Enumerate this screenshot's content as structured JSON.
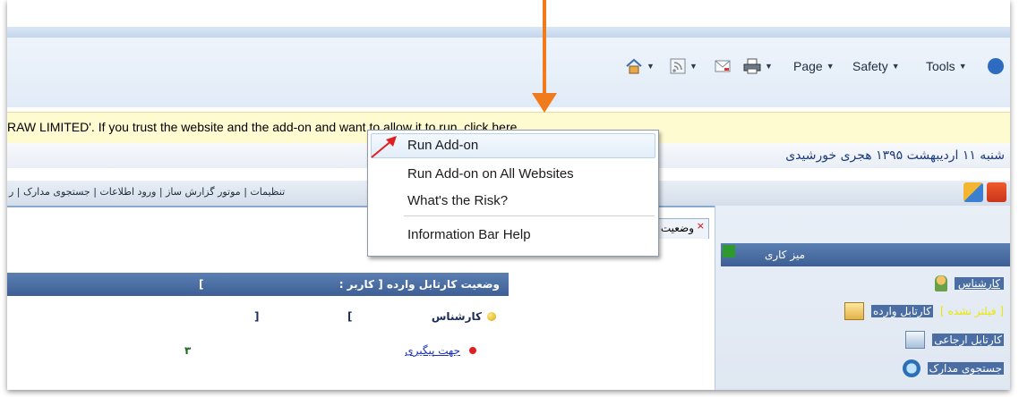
{
  "toolbar": {
    "page_label": "Page",
    "safety_label": "Safety",
    "tools_label": "Tools"
  },
  "infobar": {
    "text": "RAW LIMITED'. If you trust the website and the add-on and want to allow it to run, click here..."
  },
  "context_menu": {
    "items": [
      {
        "label": "Run Add-on"
      },
      {
        "label": "Run Add-on on All Websites"
      },
      {
        "label": "What's the Risk?"
      },
      {
        "label": "Information Bar Help"
      }
    ]
  },
  "app": {
    "date": "شنبه ۱۱ اردیبهشت ۱۳۹۵ هجری خورشیدی",
    "menu": "تنظیمات | موتور گزارش ساز | ورود اطلاعات | جستجوی مدارک | ر",
    "tab_label": "وضعیت",
    "panel": {
      "title": "وضعیت کارتابل وارده [ کاربر :",
      "bracket_close": "]",
      "role": "کارشناس",
      "bracket_open": "[",
      "bracket_close_2": "]",
      "item_label": "جهت پیگیری",
      "item_count": "۳"
    },
    "side": {
      "header": "میز کاری",
      "user_role": "کارشناس",
      "items": [
        {
          "label": "کارتابل وارده",
          "highlight": "[ فیلتر نشده ]"
        },
        {
          "label": "کارتابل ارجاعی"
        },
        {
          "label": "جستجوی مدارک"
        }
      ]
    }
  },
  "colors": {
    "annotation_arrow": "#f07a1c",
    "pointer_arrow": "#e0201f",
    "infobar_bg": "#fffbd0",
    "panel_header": "#4a6ea4"
  }
}
